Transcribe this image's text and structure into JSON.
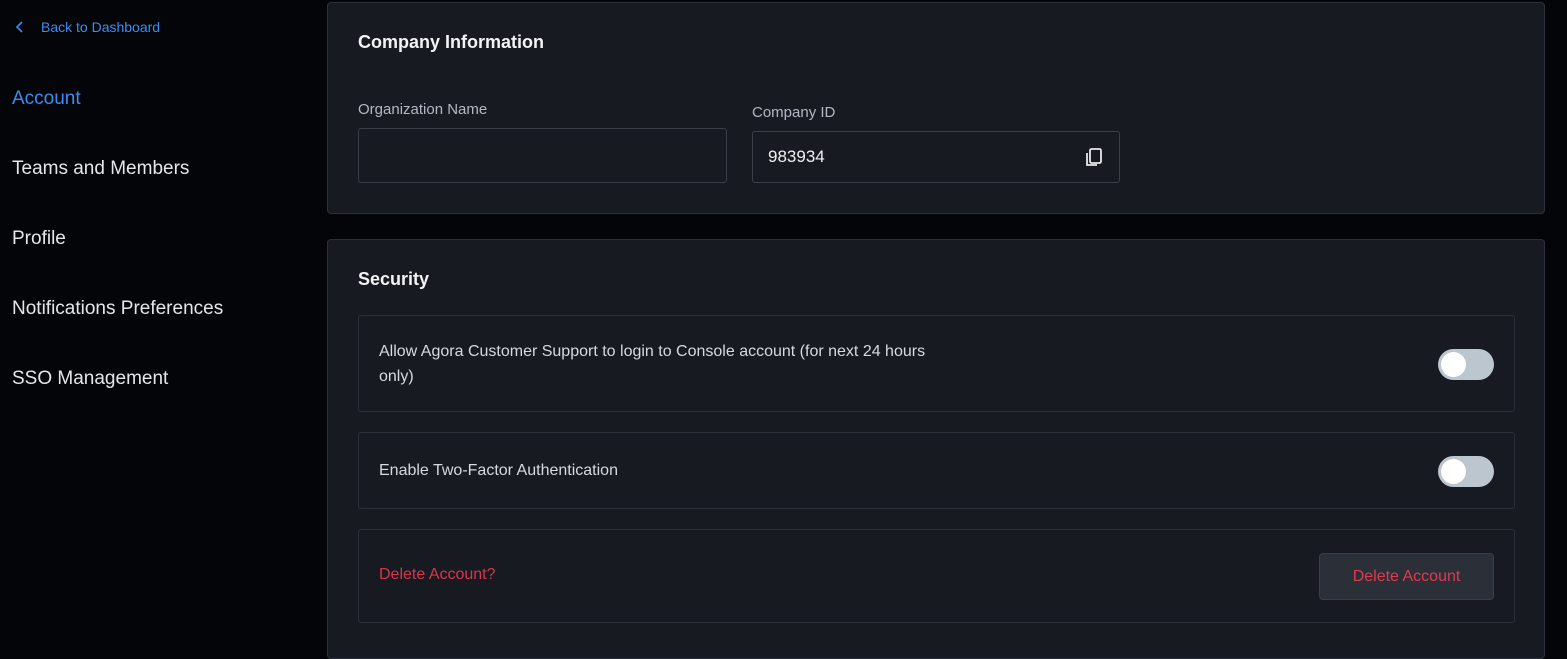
{
  "sidebar": {
    "back_label": "Back to Dashboard",
    "items": [
      {
        "label": "Account",
        "active": true
      },
      {
        "label": "Teams and Members"
      },
      {
        "label": "Profile"
      },
      {
        "label": "Notifications Preferences"
      },
      {
        "label": "SSO Management"
      }
    ]
  },
  "company": {
    "title": "Company Information",
    "org_name_label": "Organization Name",
    "org_name_value": "",
    "company_id_label": "Company ID",
    "company_id_value": "983934"
  },
  "security": {
    "title": "Security",
    "support_login_label": "Allow Agora Customer Support to login to Console account (for next 24 hours only)",
    "support_login_enabled": false,
    "two_factor_label": "Enable Two-Factor Authentication",
    "two_factor_enabled": false,
    "delete_prompt": "Delete Account?",
    "delete_button_label": "Delete Account"
  },
  "colors": {
    "accent": "#3d8df0",
    "danger": "#d9354a",
    "background": "#030508",
    "card": "#171a21"
  }
}
